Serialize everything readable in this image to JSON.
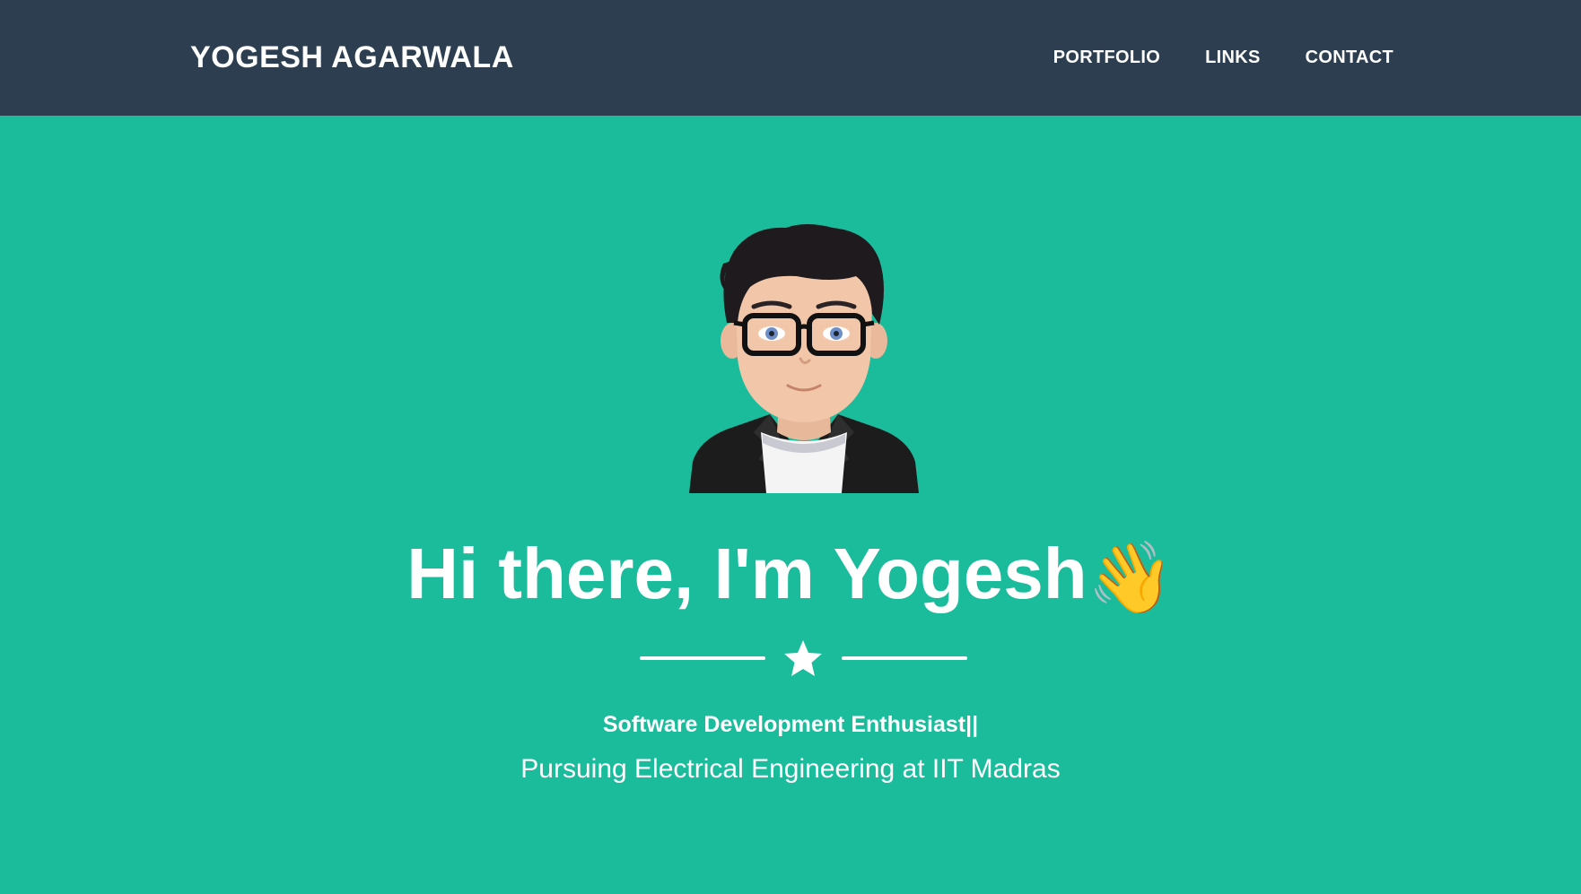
{
  "navbar": {
    "brand": "YOGESH AGARWALA",
    "links": [
      {
        "label": "PORTFOLIO"
      },
      {
        "label": "LINKS"
      },
      {
        "label": "CONTACT"
      }
    ],
    "background_color": "#2c3e50"
  },
  "hero": {
    "avatar_icon": "cartoon-avatar-with-glasses",
    "greeting": "Hi there, I'm Yogesh",
    "greeting_emoji": "👋",
    "divider_icon": "star-icon",
    "subtitle": "Software Development Enthusiast||",
    "tagline": "Pursuing Electrical Engineering at IIT Madras",
    "background_color": "#1abc9c"
  }
}
